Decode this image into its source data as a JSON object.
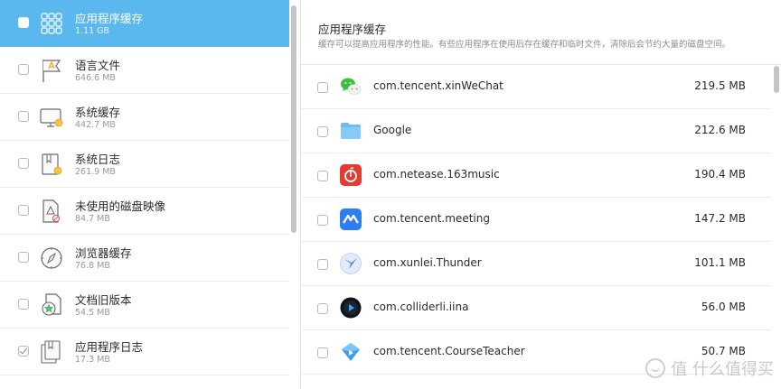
{
  "sidebar": {
    "items": [
      {
        "label": "应用程序缓存",
        "size": "1.11 GB",
        "icon": "app-cache-icon",
        "checked": false,
        "selected": true
      },
      {
        "label": "语言文件",
        "size": "646.6 MB",
        "icon": "language-flag-icon",
        "checked": false,
        "selected": false
      },
      {
        "label": "系统缓存",
        "size": "442.7 MB",
        "icon": "monitor-icon",
        "checked": false,
        "selected": false
      },
      {
        "label": "系统日志",
        "size": "261.9 MB",
        "icon": "log-book-icon",
        "checked": false,
        "selected": false
      },
      {
        "label": "未使用的磁盘映像",
        "size": "84.7 MB",
        "icon": "disk-image-icon",
        "checked": false,
        "selected": false
      },
      {
        "label": "浏览器缓存",
        "size": "76.8 MB",
        "icon": "compass-icon",
        "checked": false,
        "selected": false
      },
      {
        "label": "文档旧版本",
        "size": "54.5 MB",
        "icon": "document-versions-icon",
        "checked": false,
        "selected": false
      },
      {
        "label": "应用程序日志",
        "size": "17.3 MB",
        "icon": "app-log-icon",
        "checked": true,
        "selected": false
      }
    ]
  },
  "detail": {
    "title": "应用程序缓存",
    "description": "缓存可以提高应用程序的性能。有些应用程序在使用后存在缓存和临时文件，清除后会节约大量的磁盘空间。",
    "apps": [
      {
        "name": "com.tencent.xinWeChat",
        "size": "219.5 MB",
        "icon": "wechat-icon"
      },
      {
        "name": "Google",
        "size": "212.6 MB",
        "icon": "folder-icon"
      },
      {
        "name": "com.netease.163music",
        "size": "190.4 MB",
        "icon": "netease-music-icon"
      },
      {
        "name": "com.tencent.meeting",
        "size": "147.2 MB",
        "icon": "tencent-meeting-icon"
      },
      {
        "name": "com.xunlei.Thunder",
        "size": "101.1 MB",
        "icon": "thunder-icon"
      },
      {
        "name": "com.colliderli.iina",
        "size": "56.0 MB",
        "icon": "iina-icon"
      },
      {
        "name": "com.tencent.CourseTeacher",
        "size": "50.7 MB",
        "icon": "course-teacher-icon"
      }
    ]
  },
  "watermark": {
    "text": "值 什么值得买"
  },
  "colors": {
    "selected_bg": "#5ab8ef",
    "separator": "#ececec"
  }
}
